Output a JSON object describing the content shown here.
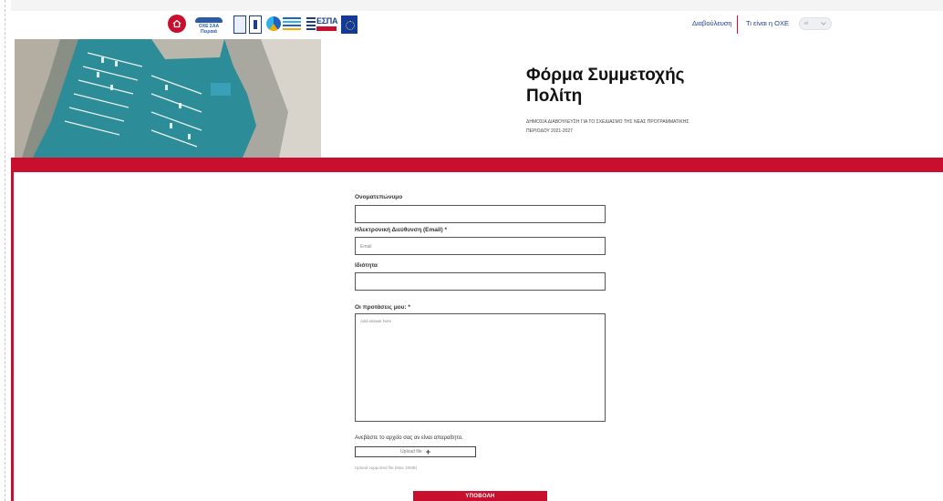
{
  "header": {
    "logo_oxe_text": "ΟΧΕ ΣΑΑ Πειραιά",
    "logo_espa_text": "ΕΣΠΑ",
    "nav": [
      "Διαβούλευση",
      "Τι είναι η ΟΧΕ"
    ],
    "language": "el"
  },
  "hero": {
    "title": "Φόρμα Συμμετοχής Πολίτη",
    "subtitle": "ΔΗΜΟΣΙΑ ΔΙΑΒΟΥΛΕΥΣΗ ΓΙΑ ΤΟ ΣΧΕΔΙΑΣΜΟ ΤΗΣ ΝΕΑΣ ΠΡΟΓΡΑΜΜΑΤΙΚΗΣ ΠΕΡΙΟΔΟΥ 2021-2027"
  },
  "form": {
    "name_label": "Ονοματεπώνυμο",
    "email_label": "Ηλεκτρονική Διεύθυνση (Email) *",
    "email_placeholder": "Email",
    "role_label": "Ιδιότητα",
    "proposals_label": "Οι προτάσεις μου: *",
    "proposals_placeholder": "Add answer here",
    "upload_label": "Ανεβάστε το αρχείο σας αν είναι απαραίτητο.",
    "upload_button": "Upload file",
    "upload_hint": "Upload supported file (Max 15MB)",
    "submit_label": "ΥΠΟΒΟΛΗ"
  },
  "colors": {
    "accent": "#c8102e",
    "nav": "#1f3c88"
  }
}
